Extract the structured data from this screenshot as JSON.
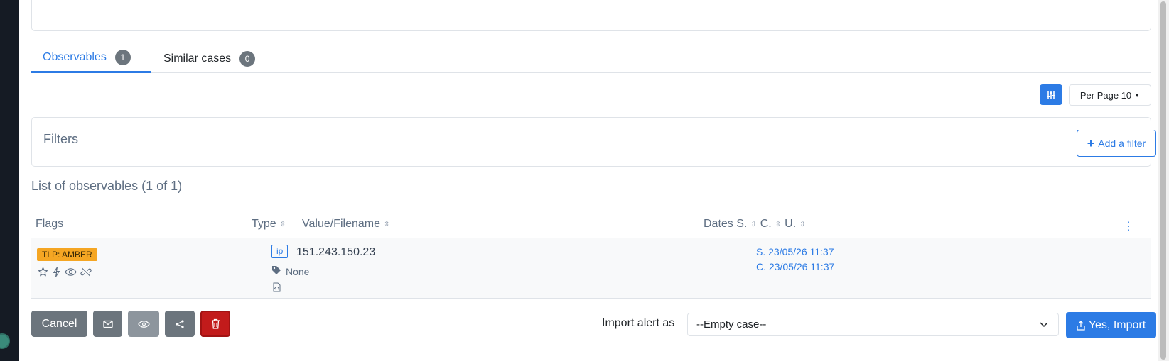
{
  "tabs": [
    {
      "label": "Observables",
      "count": "1"
    },
    {
      "label": "Similar cases",
      "count": "0"
    }
  ],
  "toolbar": {
    "per_page_label": "Per Page 10"
  },
  "filters": {
    "title": "Filters",
    "add_label": "Add a filter"
  },
  "list": {
    "title": "List of observables (1 of 1)",
    "headers": {
      "flags": "Flags",
      "type": "Type",
      "value": "Value/Filename",
      "dates": "Dates S.",
      "created": "C.",
      "updated": "U."
    },
    "rows": [
      {
        "tlp": "TLP: AMBER",
        "type": "ip",
        "value": "151.243.150.23",
        "tags": "None",
        "date_s": "S. 23/05/26 11:37",
        "date_c": "C. 23/05/26 11:37"
      }
    ]
  },
  "footer": {
    "cancel_label": "Cancel",
    "import_label": "Import alert as",
    "select_value": "--Empty case--",
    "yes_import_label": "Yes, Import"
  },
  "colors": {
    "primary": "#2c7be5",
    "tlp_amber": "#f5a623",
    "danger": "#c21b1b",
    "secondary": "#6c757d"
  }
}
